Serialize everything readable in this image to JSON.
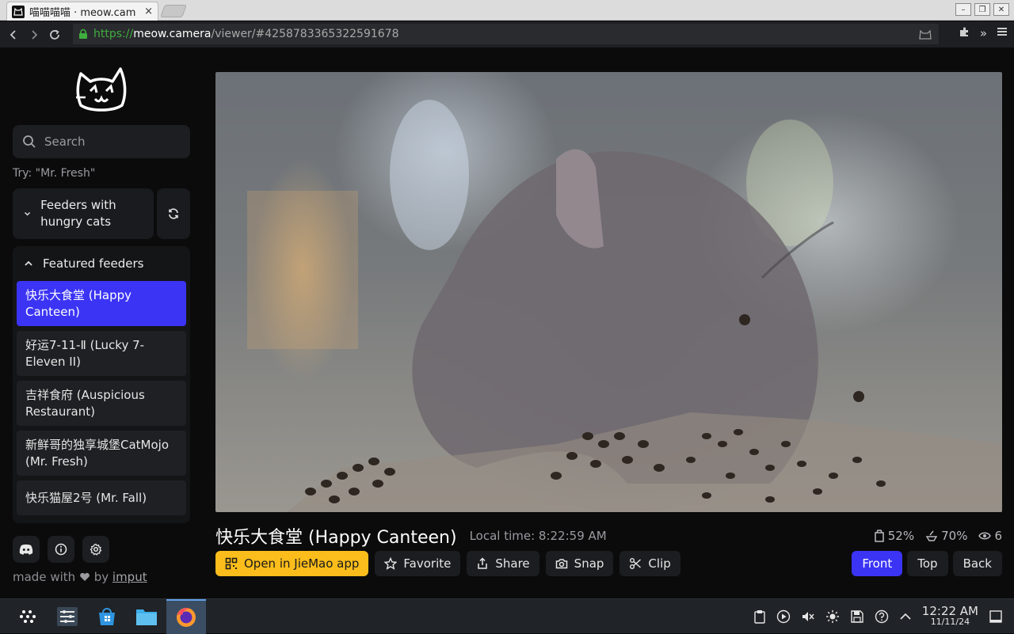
{
  "browser": {
    "tab_title": "喵喵喵喵 · meow.cam",
    "tab_close": "×",
    "url_scheme": "https://",
    "url_host": "meow.camera",
    "url_path": "/viewer/#4258783365322591678",
    "window_controls": [
      "–",
      "❐",
      "✕"
    ],
    "nav_icons": [
      "back-icon",
      "forward-icon",
      "reload-icon"
    ],
    "toolbar_icons": [
      "extensions-icon",
      "overflow-chevron-icon",
      "menu-icon"
    ]
  },
  "sidebar": {
    "search_placeholder": "Search",
    "search_hint": "Try: \"Mr. Fresh\"",
    "hungry_label": "Feeders with hungry cats",
    "featured_label": "Featured feeders",
    "feeders": [
      {
        "label": "快乐大食堂 (Happy Canteen)",
        "active": true
      },
      {
        "label": "好运7-11-Ⅱ (Lucky 7-Eleven II)",
        "active": false
      },
      {
        "label": "吉祥食府 (Auspicious Restaurant)",
        "active": false
      },
      {
        "label": "新鲜哥的独享城堡CatMojo (Mr. Fresh)",
        "active": false
      },
      {
        "label": "快乐猫屋2号 (Mr. Fall)",
        "active": false
      }
    ],
    "made_with_prefix": "made with",
    "made_with_by": "by",
    "made_with_link": "imput"
  },
  "viewer": {
    "feed_title": "快乐大食堂 (Happy Canteen)",
    "local_time": "Local time: 8:22:59 AM",
    "food_level": "52%",
    "dish_level": "70%",
    "viewers": "6"
  },
  "actions": {
    "open_app": "Open in JieMao app",
    "favorite": "Favorite",
    "share": "Share",
    "snap": "Snap",
    "clip": "Clip"
  },
  "views": {
    "front": "Front",
    "top": "Top",
    "back": "Back",
    "active": "Front"
  },
  "taskbar": {
    "time": "12:22 AM",
    "date": "11/11/24"
  },
  "colors": {
    "accent": "#3b34f5",
    "primary_button": "#fbbd1b",
    "background": "#0b0b0c"
  }
}
